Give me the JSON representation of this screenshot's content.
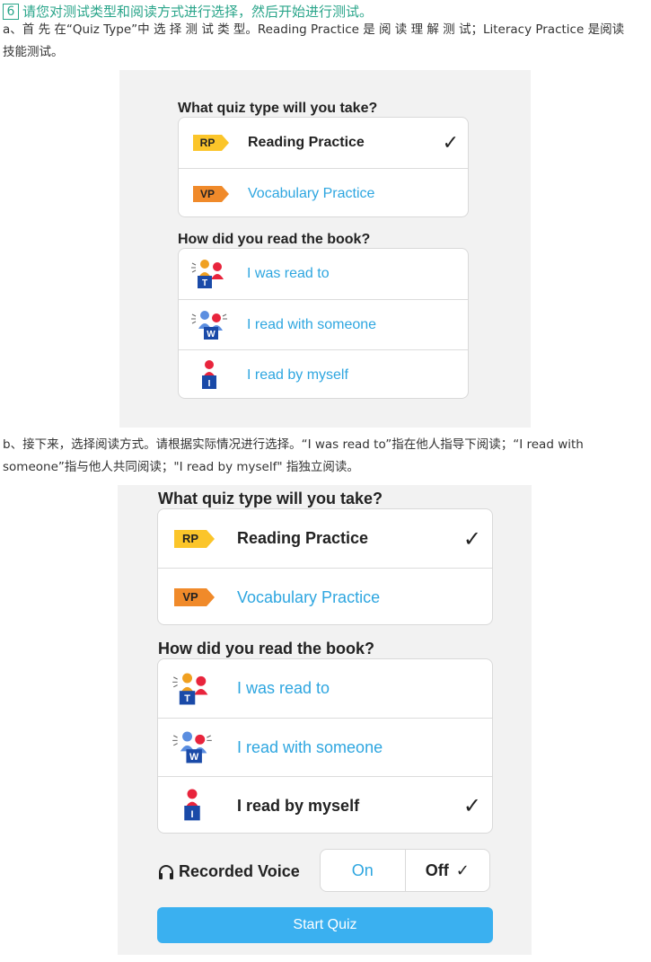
{
  "step": {
    "number": "6",
    "title": "请您对测试类型和阅读方式进行选择，然后开始进行测试。"
  },
  "para_a": {
    "line1": "a、首 先 在“Quiz Type”中 选 择 测 试 类 型。Reading Practice 是 阅 读 理 解 测 试；Literacy Practice 是阅读",
    "line2": "技能测试。"
  },
  "para_b": {
    "line1": "b、接下来，选择阅读方式。请根据实际情况进行选择。“I was read to”指在他人指导下阅读；“I read with",
    "line2": "someone”指与他人共同阅读；\"I read by myself\" 指独立阅读。"
  },
  "colors": {
    "accent_blue": "#2ea6e0",
    "rp_tag": "#fbc52a",
    "vp_tag": "#f08a2a",
    "start_button": "#3ab0f0",
    "heading_green": "#2aa58a"
  },
  "screen1": {
    "quiz_type_heading": "What quiz type will you take?",
    "quiz_types": [
      {
        "tag": "RP",
        "label": "Reading Practice",
        "selected": true,
        "icon": "rp-tag-icon"
      },
      {
        "tag": "VP",
        "label": "Vocabulary Practice",
        "selected": false,
        "icon": "vp-tag-icon"
      }
    ],
    "read_heading": "How did you read the book?",
    "read_modes": [
      {
        "label": "I was read to",
        "selected": false,
        "icon": "teacher-reading-icon",
        "badge": "T"
      },
      {
        "label": "I read with someone",
        "selected": false,
        "icon": "paired-reading-icon",
        "badge": "W"
      },
      {
        "label": "I read by myself",
        "selected": false,
        "icon": "independent-reading-icon",
        "badge": "I"
      }
    ],
    "check_mark": "✓"
  },
  "screen2": {
    "quiz_type_heading": "What quiz type will you take?",
    "quiz_types": [
      {
        "tag": "RP",
        "label": "Reading Practice",
        "selected": true
      },
      {
        "tag": "VP",
        "label": "Vocabulary Practice",
        "selected": false
      }
    ],
    "read_heading": "How did you read the book?",
    "read_modes": [
      {
        "label": "I was read to",
        "selected": false,
        "badge": "T"
      },
      {
        "label": "I read with someone",
        "selected": false,
        "badge": "W"
      },
      {
        "label": "I read by myself",
        "selected": true,
        "badge": "I"
      }
    ],
    "check_mark": "✓",
    "recorded_voice": {
      "label": "Recorded Voice",
      "icon": "headphones-icon",
      "on_label": "On",
      "off_label": "Off",
      "selected": "Off"
    },
    "start_button_label": "Start Quiz"
  }
}
